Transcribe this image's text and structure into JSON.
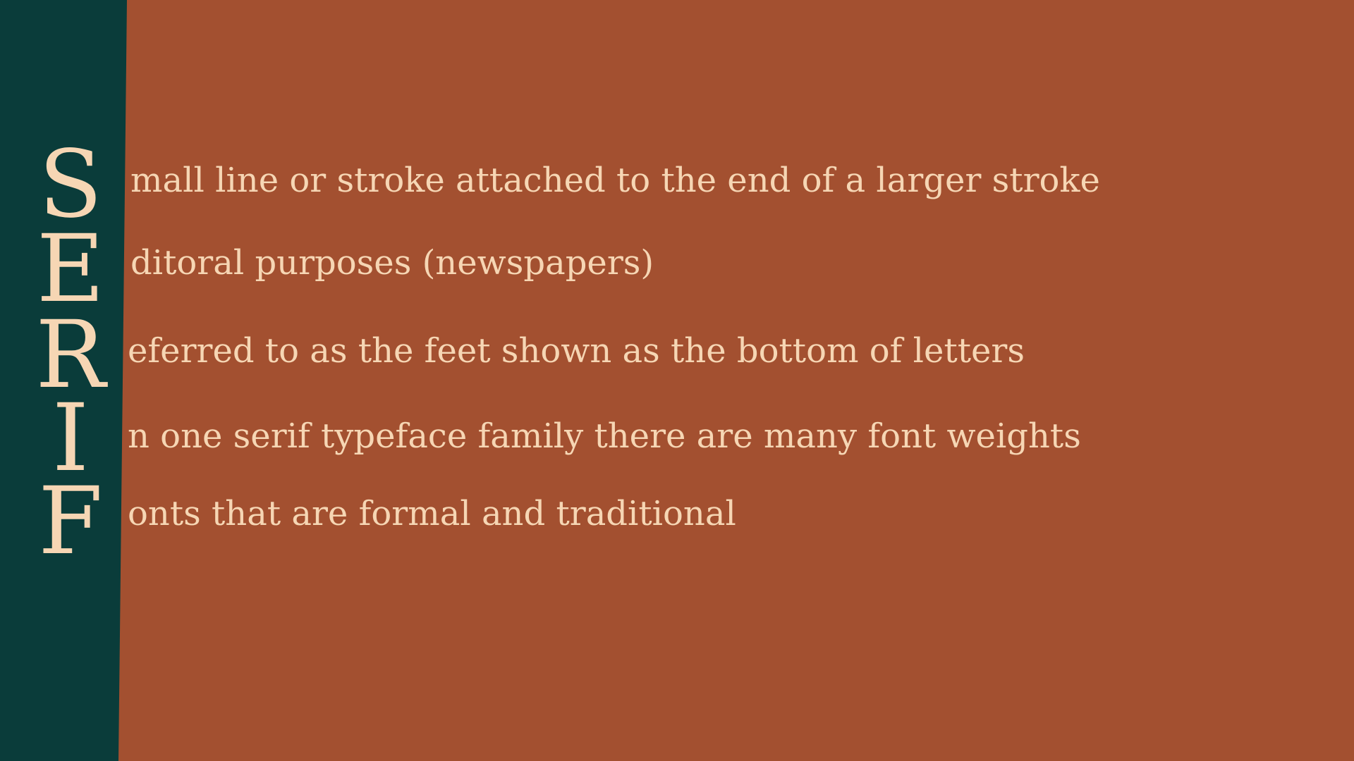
{
  "colors": {
    "background": "#A35030",
    "sidebar": "#0A3C3A",
    "text": "#F6D6B4"
  },
  "rows": [
    {
      "letter": "S",
      "text": "mall line or stroke attached to the end of a larger stroke"
    },
    {
      "letter": "E",
      "text": "ditoral purposes (newspapers)"
    },
    {
      "letter": "R",
      "text": "eferred to as the feet shown as the bottom of letters"
    },
    {
      "letter": "I",
      "text": "n one serif typeface family there are many font weights"
    },
    {
      "letter": "F",
      "text": "onts that are formal and traditional"
    }
  ]
}
